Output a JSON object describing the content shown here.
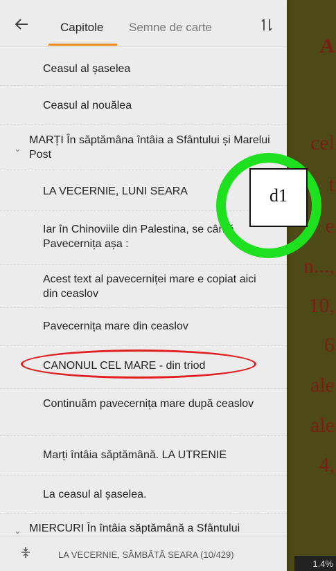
{
  "header": {
    "tabs": [
      {
        "label": "Capitole",
        "active": true
      },
      {
        "label": "Semne de carte",
        "active": false
      }
    ]
  },
  "toc": [
    {
      "text": "Ceasul al șaselea"
    },
    {
      "text": "Ceasul al nouălea"
    },
    {
      "text": "MARȚI În săptămâna întâia a Sfântului și Marelui Post"
    },
    {
      "text": "LA VECERNIE, LUNI SEARA"
    },
    {
      "text": "Iar în Chinoviile din Palestina, se cântă Pavecernița așa :"
    },
    {
      "text": "Acest text al pavecerniței mare e copiat aici din ceaslov"
    },
    {
      "text": "Pavecernița mare din ceaslov"
    },
    {
      "text": "CANONUL CEL MARE - din triod"
    },
    {
      "text": "Continuăm pavecernița mare după ceaslov"
    },
    {
      "text": "Marți întâia săptămână. LA UTRENIE"
    },
    {
      "text": "La ceasul al șaselea."
    },
    {
      "text": "MIERCURI În întâia săptămână a Sfântului"
    }
  ],
  "footer": {
    "text": "LA VECERNIE, SÂMBĂTĂ SEARA (10/429)"
  },
  "reader": {
    "lines": [
      "A",
      "cel",
      "t",
      "e",
      "n...,",
      "10,",
      "6",
      "ale",
      "ale",
      "4,"
    ],
    "progress": "1.4%"
  },
  "annotation": {
    "label": "d1"
  },
  "colors": {
    "accent": "#f08a1c",
    "annotation_green": "#1ee01e",
    "annotation_red": "#e02020"
  }
}
